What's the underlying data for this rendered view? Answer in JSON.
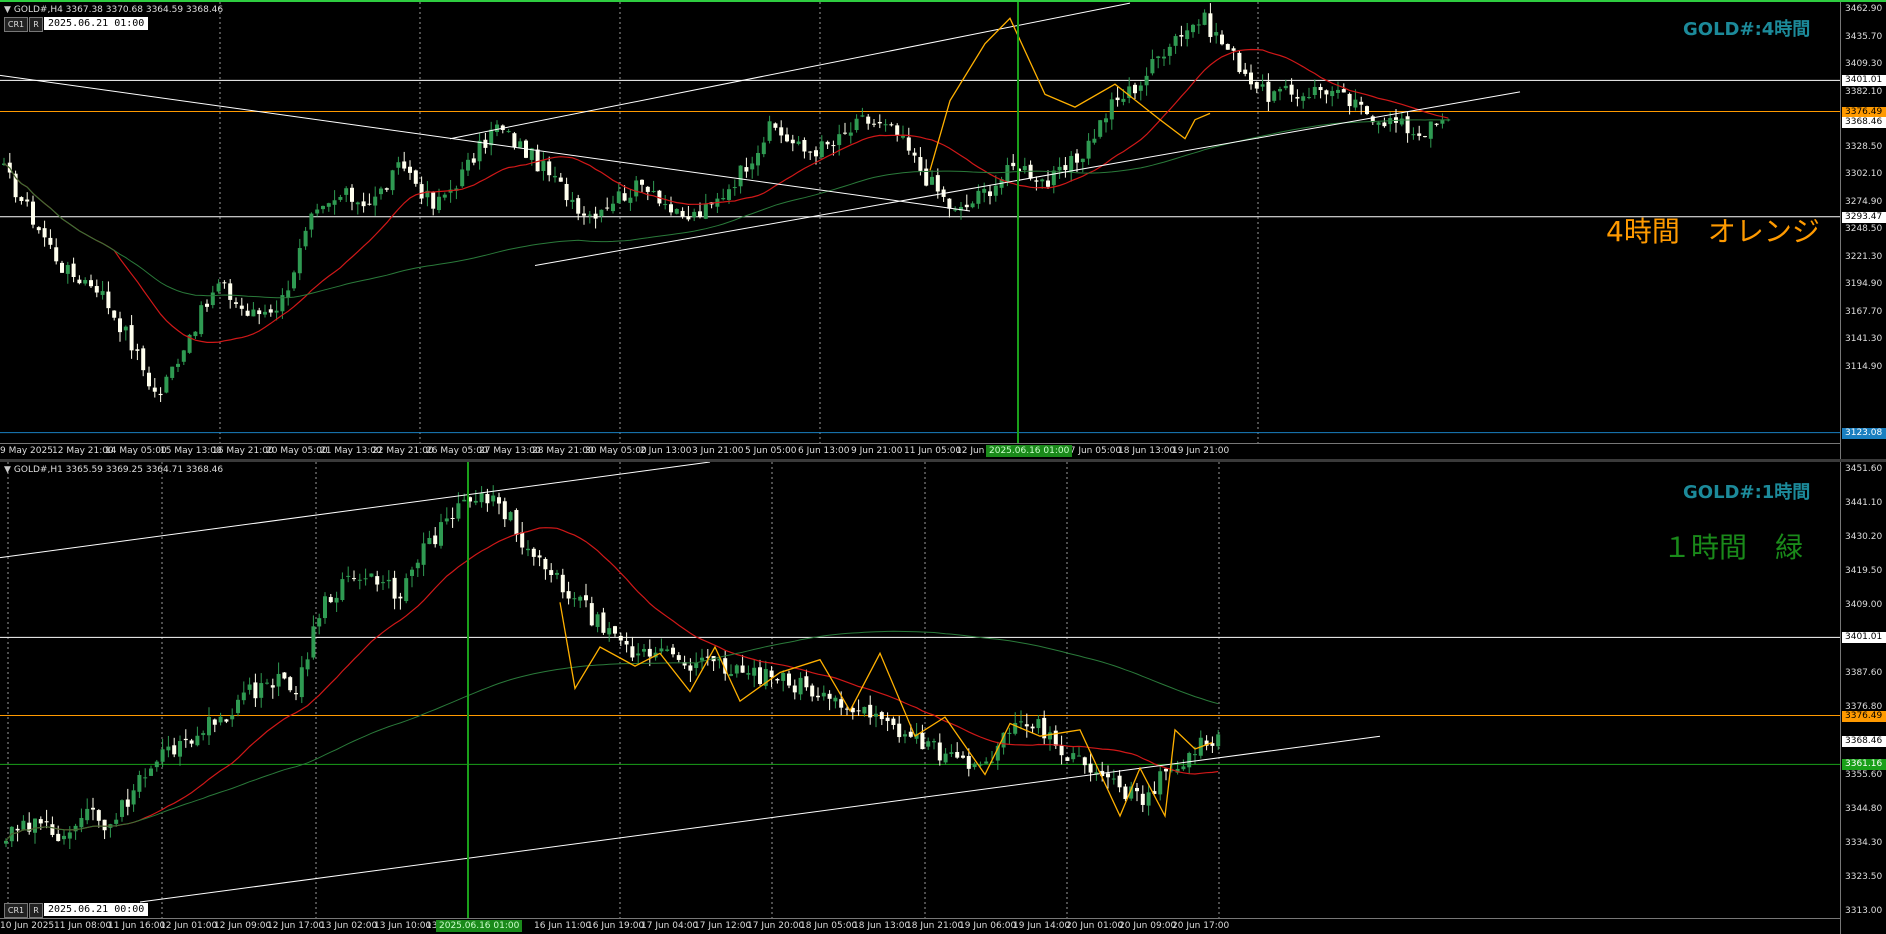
{
  "colors": {
    "background": "#000000",
    "bull": "#2f9a52",
    "bear": "#ffffee",
    "ma_red": "#d01818",
    "ma_green": "#2a7a3a",
    "zigzag": "#ffb000",
    "orange_level": "#ff9a00",
    "selected_bar": "#1aa01a",
    "title": "#1c8a9a"
  },
  "pane_h4": {
    "header": "GOLD#,H4  3367.38 3370.68 3364.59 3368.46",
    "btn_cr": "CR1",
    "btn_r": "R",
    "date_box": "2025.06.21 01:00",
    "title": "GOLD#:4時間",
    "note": "4時間　オレンジ",
    "y_labels": [
      "3462.90",
      "3435.70",
      "3409.30",
      "3382.10",
      "3355.70",
      "3328.50",
      "3302.10",
      "3274.90",
      "3248.50",
      "3221.30",
      "3194.90",
      "3167.70",
      "3141.30",
      "3114.90"
    ],
    "y_tags": [
      {
        "text": "3401.01",
        "value": 3401.01,
        "bg": "#ffffff",
        "fg": "#000000"
      },
      {
        "text": "3376.49",
        "value": 3376.49,
        "bg": "#ff9a00",
        "fg": "#000000"
      },
      {
        "text": "3368.46",
        "value": 3368.46,
        "bg": "#ffffff",
        "fg": "#000000"
      },
      {
        "text": "3293.47",
        "value": 3293.47,
        "bg": "#ffffff",
        "fg": "#000000"
      },
      {
        "text": "3123.08",
        "value": 3123.08,
        "bg": "#1a7fc0",
        "fg": "#ffffff"
      }
    ],
    "x_labels": [
      "9 May 2025",
      "12 May 21:00",
      "14 May 05:00",
      "15 May 13:00",
      "16 May 21:00",
      "20 May 05:00",
      "21 May 13:00",
      "22 May 21:00",
      "26 May 05:00",
      "27 May 13:00",
      "28 May 21:00",
      "30 May 05:00",
      "2 Jun 13:00",
      "3 Jun 21:00",
      "5 Jun 05:00",
      "6 Jun 13:00",
      "9 Jun 21:00",
      "11 Jun 05:00",
      "12 Jun",
      "17 Jun 05:00",
      "18 Jun 13:00",
      "19 Jun 21:00"
    ],
    "x_tag": "2025.06.16 01:00",
    "price_range": [
      3114.9,
      3462.9
    ],
    "h_levels": [
      3462.9,
      3401.01,
      3376.49,
      3293.47,
      3123.08
    ],
    "current": 3368.46
  },
  "pane_h1": {
    "header": "GOLD#,H1  3365.59 3369.25 3364.71 3368.46",
    "btn_cr": "CR1",
    "btn_r": "R",
    "date_box": "2025.06.21 00:00",
    "title": "GOLD#:1時間",
    "note": "１時間　緑",
    "y_labels": [
      "3451.60",
      "3441.10",
      "3430.20",
      "3419.50",
      "3409.00",
      "3398.20",
      "3387.60",
      "3376.80",
      "3366.20",
      "3355.60",
      "3344.80",
      "3334.30",
      "3323.50",
      "3313.00"
    ],
    "y_tags": [
      {
        "text": "3401.01",
        "value": 3401.01,
        "bg": "#ffffff",
        "fg": "#000000"
      },
      {
        "text": "3376.49",
        "value": 3376.49,
        "bg": "#ff9a00",
        "fg": "#000000"
      },
      {
        "text": "3368.46",
        "value": 3368.46,
        "bg": "#ffffff",
        "fg": "#000000"
      },
      {
        "text": "3361.16",
        "value": 3361.16,
        "bg": "#1aa01a",
        "fg": "#ffffff"
      }
    ],
    "x_labels": [
      "10 Jun 2025",
      "11 Jun 08:00",
      "11 Jun 16:00",
      "12 Jun 01:00",
      "12 Jun 09:00",
      "12 Jun 17:00",
      "13 Jun 02:00",
      "13 Jun 10:00",
      "13 Jun",
      "16 Jun 11:00",
      "16 Jun 19:00",
      "17 Jun 04:00",
      "17 Jun 12:00",
      "17 Jun 20:00",
      "18 Jun 05:00",
      "18 Jun 13:00",
      "18 Jun 21:00",
      "19 Jun 06:00",
      "19 Jun 14:00",
      "20 Jun 01:00",
      "20 Jun 09:00",
      "20 Jun 17:00"
    ],
    "x_tag": "2025.06.16 01:00",
    "price_range": [
      3313.0,
      3456.0
    ],
    "h_levels": [
      3401.01,
      3376.49,
      3361.16
    ],
    "current": 3368.46
  }
}
